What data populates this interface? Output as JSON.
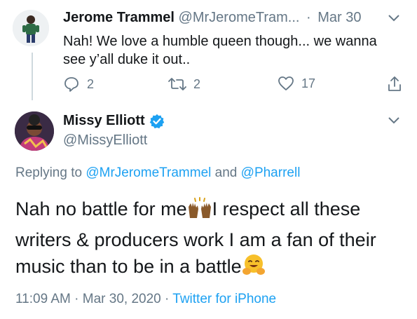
{
  "reply_tweet": {
    "author_name": "Jerome Trammel",
    "handle": "@MrJeromeTram...",
    "separator": "·",
    "date": "Mar 30",
    "text": "Nah! We love a humble queen though... we wanna see y’all duke it out..",
    "reply_count": "2",
    "retweet_count": "2",
    "like_count": "17"
  },
  "main_tweet": {
    "author_name": "Missy Elliott",
    "handle": "@MissyElliott",
    "replying_to_label": "Replying to",
    "replying_to_user1": "@MrJeromeTrammel",
    "replying_to_and": "and",
    "replying_to_user2": "@Pharrell",
    "text_part1": "Nah no battle for me",
    "text_part2": "I respect all these writers & producers work I am a fan of their music than to be in a battle",
    "time": "11:09 AM",
    "separator1": "·",
    "date": "Mar 30, 2020",
    "separator2": "·",
    "source": "Twitter for iPhone"
  },
  "icons": {
    "reply": "reply-icon",
    "retweet": "retweet-icon",
    "like": "heart-icon",
    "share": "share-icon",
    "verified": "verified-badge-icon",
    "more": "chevron-down-icon",
    "raising_hands": "raising-hands-emoji",
    "hugging": "hugging-face-emoji"
  },
  "colors": {
    "link": "#1da1f2",
    "muted": "#657786",
    "text": "#14171a",
    "verified": "#1da1f2"
  }
}
